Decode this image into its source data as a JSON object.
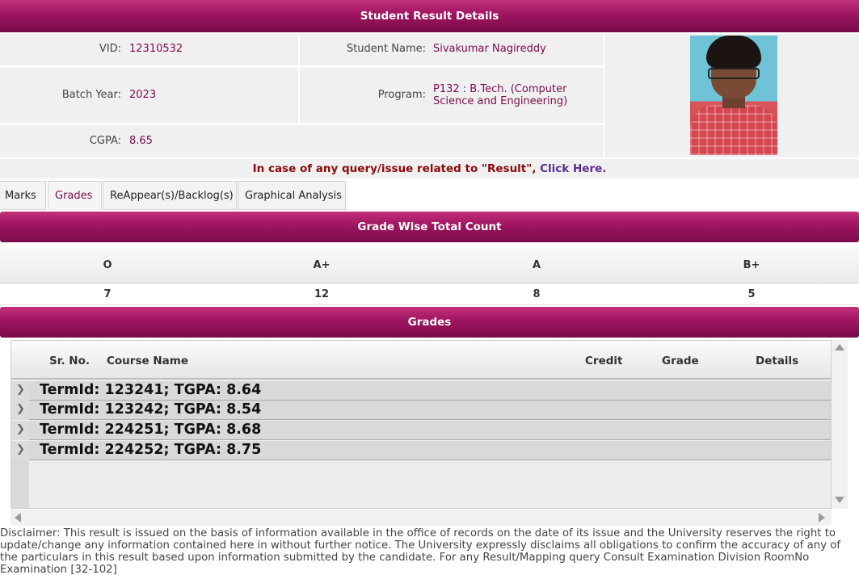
{
  "header": {
    "title": "Student Result Details"
  },
  "student": {
    "vid_label": "VID:",
    "vid": "12310532",
    "name_label": "Student Name:",
    "name": "Sivakumar Nagireddy",
    "batch_label": "Batch Year:",
    "batch": "2023",
    "program_label": "Program:",
    "program": "P132 : B.Tech. (Computer Science and Engineering)",
    "cgpa_label": "CGPA:",
    "cgpa": "8.65"
  },
  "query": {
    "text": "In case of any query/issue related to \"Result\",",
    "link": "Click Here."
  },
  "tabs": [
    {
      "label": "Marks"
    },
    {
      "label": "Grades"
    },
    {
      "label": "ReAppear(s)/Backlog(s)"
    },
    {
      "label": "Graphical Analysis"
    }
  ],
  "grade_count": {
    "title": "Grade Wise Total Count",
    "headers": [
      "O",
      "A+",
      "A",
      "B+"
    ],
    "values": [
      "7",
      "12",
      "8",
      "5"
    ]
  },
  "grades": {
    "title": "Grades",
    "columns": {
      "sr": "Sr. No.",
      "course": "Course Name",
      "credit": "Credit",
      "grade": "Grade",
      "details": "Details"
    },
    "groups": [
      {
        "label": "TermId: 123241; TGPA: 8.64"
      },
      {
        "label": "TermId: 123242; TGPA: 8.54"
      },
      {
        "label": "TermId: 224251; TGPA: 8.68"
      },
      {
        "label": "TermId: 224252; TGPA: 8.75"
      }
    ]
  },
  "disclaimer": "Disclaimer: This result is issued on the basis of information available in the office of records on the date of its issue and the University reserves the right to update/change any information contained here in without further notice. The University expressly disclaims all obligations to confirm the accuracy of any of the particulars in this result based upon information submitted by the candidate. For any Result/Mapping query Consult Examination Division RoomNo Examination [32-102]"
}
